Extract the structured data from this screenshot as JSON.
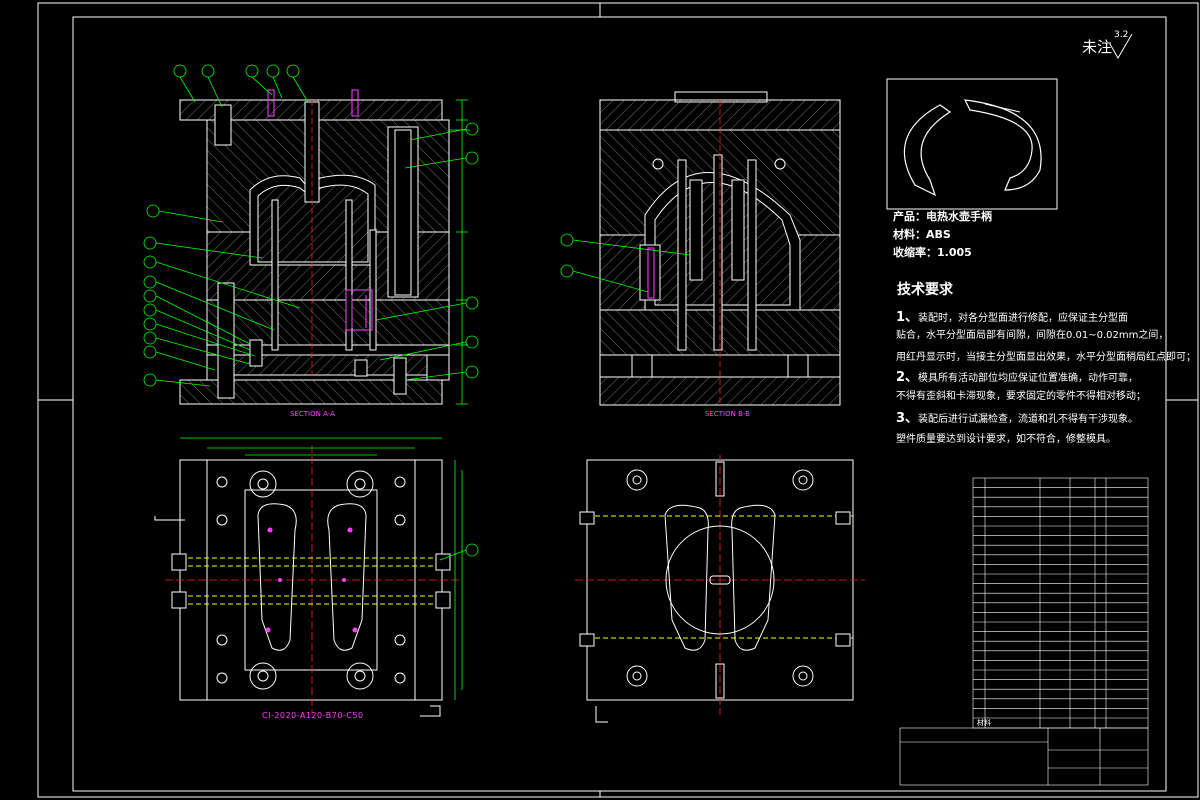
{
  "drawing": {
    "surface_note": "未注",
    "roughness": "3.2",
    "product_info": {
      "product": "产品：电热水壶手柄",
      "material": "材料：ABS",
      "shrinkage": "收缩率：1.005"
    },
    "technical_requirements": {
      "title": "技术要求",
      "items": [
        {
          "num": "1、",
          "text": "装配时，对各分型面进行修配，应保证主分型面"
        },
        {
          "num": "",
          "text": "贴合，水平分型面局部有间隙，间隙在0.01~0.02mm之间，"
        },
        {
          "num": "",
          "text": "用红丹显示时，当接主分型面显出效果，水平分型面稍局红点即可；"
        },
        {
          "num": "2、",
          "text": "模具所有活动部位均应保证位置准确，动作可靠，"
        },
        {
          "num": "",
          "text": "不得有歪斜和卡滞现象，要求固定的零件不得相对移动；"
        },
        {
          "num": "3、",
          "text": "装配后进行试漏检查，流道和孔不得有干涉现象。"
        },
        {
          "num": "",
          "text": "塑件质量要达到设计要求，如不符合，修整模具。"
        }
      ]
    },
    "views": {
      "section_a": "SECTION A-A",
      "section_b": "SECTION B-B"
    },
    "frame_code": "CI-2020-A120-B70-C50",
    "bom_header": "材料"
  },
  "colors": {
    "background": "#000000",
    "outline": "#ffffff",
    "leader": "#00ff00",
    "center": "#ff2020",
    "cooling": "#ffff00",
    "ejector": "#ff40ff",
    "hatch": "#ffffff"
  }
}
